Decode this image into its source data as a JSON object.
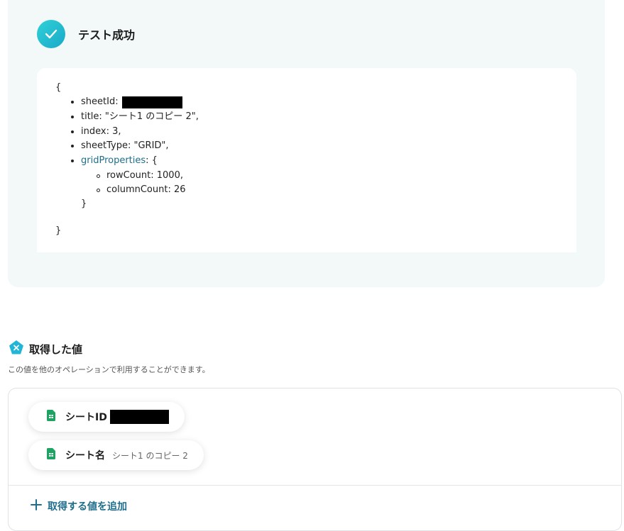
{
  "test": {
    "status_text": "テスト成功",
    "json": {
      "open_brace": "{",
      "close_brace": "}",
      "inner_close_brace": "}",
      "sheetId_key": "sheetId:",
      "title_line": "title: \"シート1 のコピー 2\",",
      "index_line": "index: 3,",
      "sheetType_line": "sheetType: \"GRID\",",
      "gridProperties_key": "gridProperties",
      "gridProperties_suffix": ": {",
      "rowCount_line": "rowCount: 1000,",
      "columnCount_line": "columnCount: 26"
    }
  },
  "retrieved": {
    "title": "取得した値",
    "description": "この値を他のオペレーションで利用することができます。",
    "items": [
      {
        "label": "シートID",
        "value": ""
      },
      {
        "label": "シート名",
        "value": "シート1 のコピー 2"
      }
    ],
    "add_label": "取得する値を追加"
  },
  "colors": {
    "accent": "#1f6e8c",
    "success_gradient_start": "#2fd1d8",
    "success_gradient_end": "#19a9c8",
    "sheets_green": "#1ea362",
    "panel_bg": "#f2f9f8"
  },
  "icons": [
    "check-icon",
    "variable-pentagon-icon",
    "google-sheets-icon",
    "plus-icon"
  ]
}
